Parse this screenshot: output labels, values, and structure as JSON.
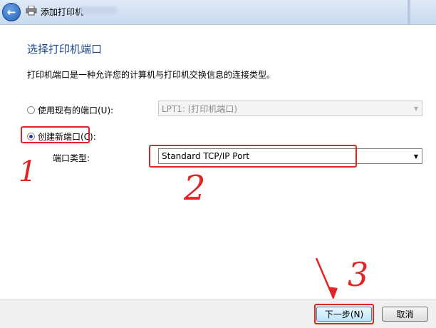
{
  "window": {
    "title": "添加打印机"
  },
  "page": {
    "heading": "选择打印机端口",
    "description": "打印机端口是一种允许您的计算机与打印机交换信息的连接类型。"
  },
  "existing_port": {
    "label": "使用现有的端口(U):",
    "selected": false,
    "select_value": "LPT1: (打印机端口)",
    "enabled": false
  },
  "new_port": {
    "label": "创建新端口(C):",
    "selected": true,
    "type_label": "端口类型:",
    "select_value": "Standard TCP/IP Port"
  },
  "buttons": {
    "next": "下一步(N)",
    "cancel": "取消"
  },
  "annotations": {
    "one": "1",
    "two": "2",
    "three": "3",
    "color": "#e12424"
  },
  "icons": {
    "back": "back-arrow-icon",
    "printer": "printer-icon",
    "dropdown": "chevron-down-icon"
  }
}
